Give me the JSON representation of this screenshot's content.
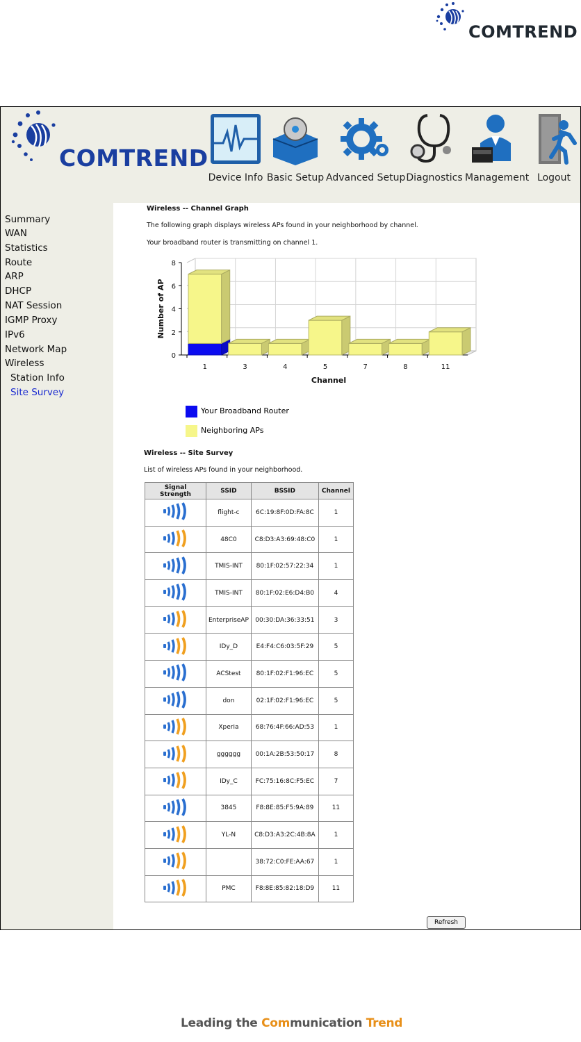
{
  "brand": {
    "name": "COMTREND"
  },
  "nav": [
    {
      "label": "Device Info",
      "icon": "device-info-icon"
    },
    {
      "label": "Basic Setup",
      "icon": "basic-setup-icon"
    },
    {
      "label": "Advanced Setup",
      "icon": "advanced-setup-icon"
    },
    {
      "label": "Diagnostics",
      "icon": "diagnostics-icon"
    },
    {
      "label": "Management",
      "icon": "management-icon"
    },
    {
      "label": "Logout",
      "icon": "logout-icon"
    }
  ],
  "sidebar": {
    "items": [
      {
        "label": "Summary"
      },
      {
        "label": "WAN"
      },
      {
        "label": "Statistics"
      },
      {
        "label": "Route"
      },
      {
        "label": "ARP"
      },
      {
        "label": "DHCP"
      },
      {
        "label": "NAT Session"
      },
      {
        "label": "IGMP Proxy"
      },
      {
        "label": "IPv6"
      },
      {
        "label": "Network Map"
      },
      {
        "label": "Wireless"
      },
      {
        "label": "Station Info"
      },
      {
        "label": "Site Survey"
      }
    ],
    "active": "Site Survey"
  },
  "channel_graph": {
    "title": "Wireless -- Channel Graph",
    "description": "The following graph displays wireless APs found in your neighborhood by channel.",
    "transmitting_note": "Your broadband router is transmitting on channel 1."
  },
  "chart_data": {
    "type": "bar",
    "stacked": true,
    "categories": [
      "1",
      "3",
      "4",
      "5",
      "7",
      "8",
      "11"
    ],
    "series": [
      {
        "name": "Your Broadband Router",
        "values": [
          1,
          0,
          0,
          0,
          0,
          0,
          0
        ],
        "color": "#0b0bf0"
      },
      {
        "name": "Neighboring APs",
        "values": [
          6,
          1,
          1,
          3,
          1,
          1,
          2
        ],
        "color": "#f6f68a"
      }
    ],
    "xlabel": "Channel",
    "ylabel": "Number of AP",
    "ylim": [
      0,
      8
    ],
    "yticks": [
      "0",
      "2",
      "4",
      "6",
      "8"
    ],
    "grid": true,
    "legend": "bottom"
  },
  "site_survey": {
    "title": "Wireless -- Site Survey",
    "description": "List of wireless APs found in your neighborhood.",
    "columns": [
      "Signal Strength",
      "SSID",
      "BSSID",
      "Channel"
    ],
    "rows": [
      {
        "signal": "blue",
        "ssid": "flight-c",
        "bssid": "6C:19:8F:0D:FA:8C",
        "channel": "1"
      },
      {
        "signal": "orange",
        "ssid": "48C0",
        "bssid": "C8:D3:A3:69:48:C0",
        "channel": "1"
      },
      {
        "signal": "blue",
        "ssid": "TMIS-INT",
        "bssid": "80:1F:02:57:22:34",
        "channel": "1"
      },
      {
        "signal": "blue",
        "ssid": "TMIS-INT",
        "bssid": "80:1F:02:E6:D4:B0",
        "channel": "4"
      },
      {
        "signal": "orange",
        "ssid": "EnterpriseAP",
        "bssid": "00:30:DA:36:33:51",
        "channel": "3"
      },
      {
        "signal": "orange",
        "ssid": "IDy_D",
        "bssid": "E4:F4:C6:03:5F:29",
        "channel": "5"
      },
      {
        "signal": "blue",
        "ssid": "ACStest",
        "bssid": "80:1F:02:F1:96:EC",
        "channel": "5"
      },
      {
        "signal": "blue",
        "ssid": "don",
        "bssid": "02:1F:02:F1:96:EC",
        "channel": "5"
      },
      {
        "signal": "orange",
        "ssid": "Xperia",
        "bssid": "68:76:4F:66:AD:53",
        "channel": "1"
      },
      {
        "signal": "orange",
        "ssid": "gggggg",
        "bssid": "00:1A:2B:53:50:17",
        "channel": "8"
      },
      {
        "signal": "orange",
        "ssid": "IDy_C",
        "bssid": "FC:75:16:8C:F5:EC",
        "channel": "7"
      },
      {
        "signal": "blue",
        "ssid": "3845",
        "bssid": "F8:8E:85:F5:9A:89",
        "channel": "11"
      },
      {
        "signal": "orange",
        "ssid": "YL-N",
        "bssid": "C8:D3:A3:2C:4B:8A",
        "channel": "1"
      },
      {
        "signal": "orange",
        "ssid": "",
        "bssid": "38:72:C0:FE:AA:67",
        "channel": "1"
      },
      {
        "signal": "orange",
        "ssid": "PMC",
        "bssid": "F8:8E:85:82:18:D9",
        "channel": "11"
      }
    ],
    "refresh_label": "Refresh"
  },
  "footer": {
    "part1": "Leading the ",
    "part2": "Com",
    "part3": "munication ",
    "part4": "Trend"
  },
  "colors": {
    "panel": "#eeeee6",
    "active_link": "#1a2ad0",
    "brand_blue": "#1a3ea0",
    "signal_blue": "#2a6fd0",
    "signal_orange": "#f0a020"
  }
}
